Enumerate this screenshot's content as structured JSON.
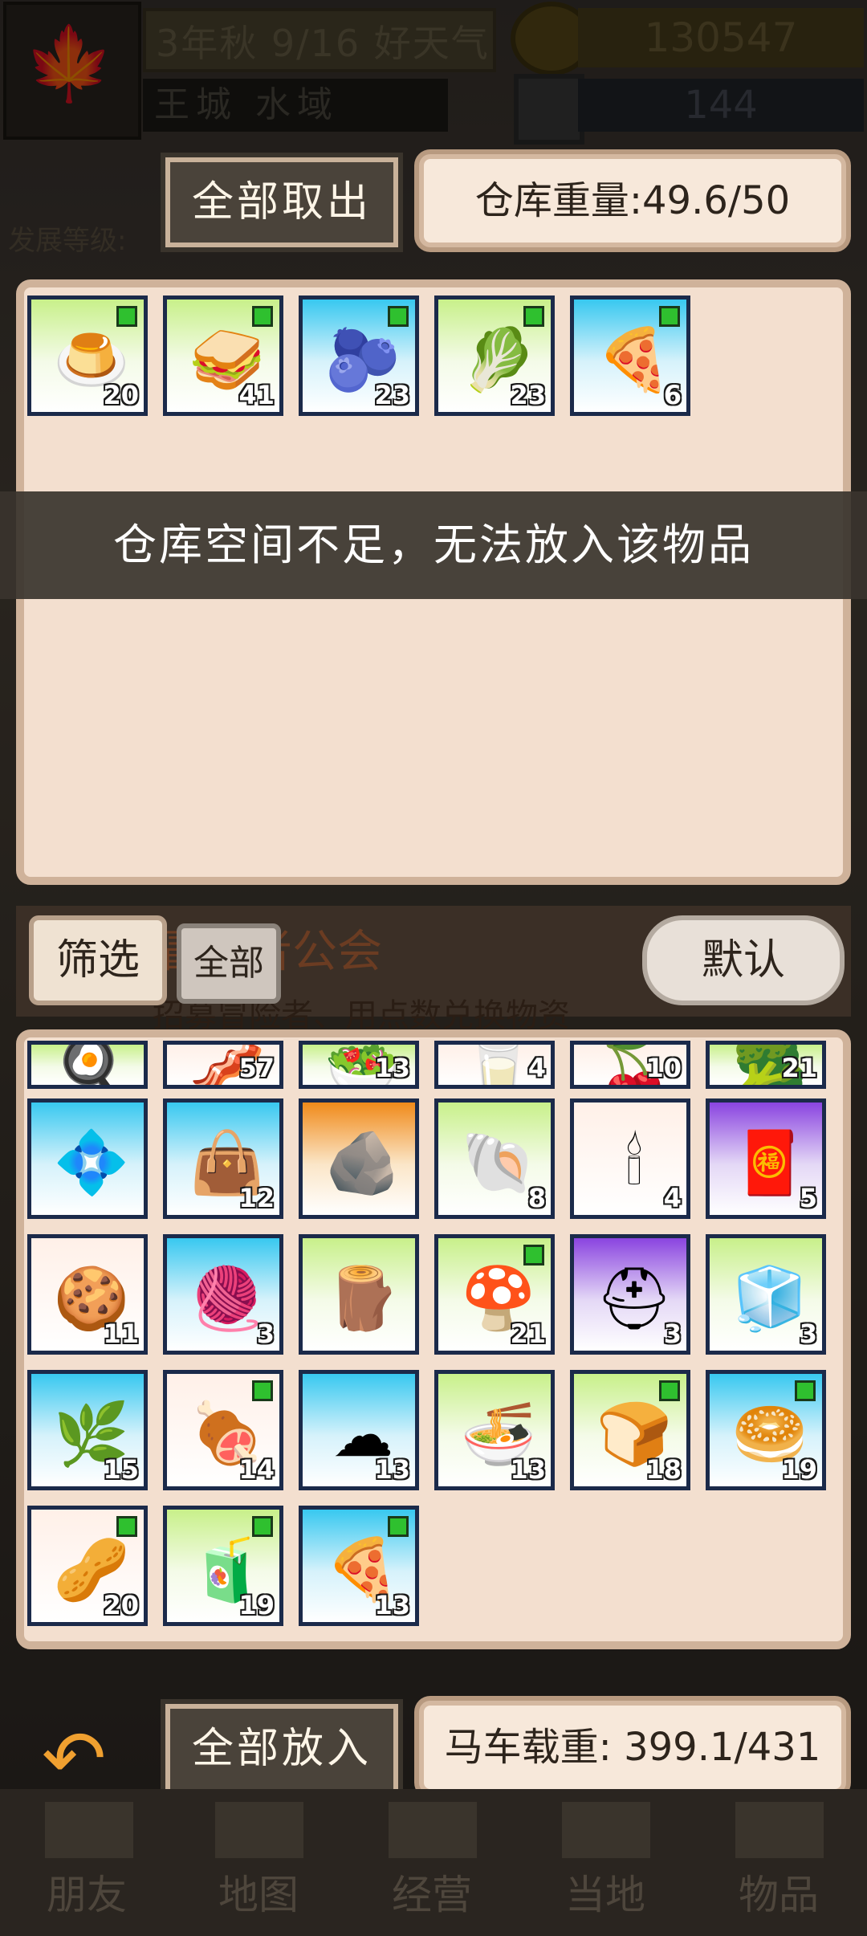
{
  "hud": {
    "date": "3年秋 9/16 好天气",
    "location": "王城 水域",
    "coins": "130547",
    "gems": "144",
    "dev_level_label": "发展等级:"
  },
  "storage": {
    "take_all_label": "全部取出",
    "weight_label": "仓库重量:49.6/50",
    "items": [
      {
        "icon": "matcha-pudding-icon",
        "glyph": "🍮",
        "qty": "20",
        "bg": "green",
        "dot": true
      },
      {
        "icon": "sandwich-icon",
        "glyph": "🥪",
        "qty": "41",
        "bg": "green",
        "dot": true
      },
      {
        "icon": "blueberry-jelly-icon",
        "glyph": "🫐",
        "qty": "23",
        "bg": "blue",
        "dot": true
      },
      {
        "icon": "radish-bundle-icon",
        "glyph": "🥬",
        "qty": "23",
        "bg": "green",
        "dot": true
      },
      {
        "icon": "pizza-slice-icon",
        "glyph": "🍕",
        "qty": "6",
        "bg": "blue",
        "dot": true
      }
    ]
  },
  "toast": "仓库空间不足，无法放入该物品",
  "filter": {
    "filter_label": "筛选",
    "all_label": "全部",
    "default_label": "默认",
    "bg_guild_text": "冒险者公会",
    "bg_guild_sub": "招募冒险者、用点数兑换物资"
  },
  "cart": {
    "partial_row": [
      "",
      "57",
      "13",
      "4",
      "10",
      "21"
    ],
    "rows": [
      [
        {
          "icon": "purple-crystal-icon",
          "glyph": "💠",
          "qty": "",
          "bg": "blue",
          "dot": false
        },
        {
          "icon": "leather-bag-icon",
          "glyph": "👜",
          "qty": "12",
          "bg": "blue",
          "dot": false
        },
        {
          "icon": "ore-stones-icon",
          "glyph": "🪨",
          "qty": "",
          "bg": "orange",
          "dot": false
        },
        {
          "icon": "snail-shell-icon",
          "glyph": "🐚",
          "qty": "8",
          "bg": "green",
          "dot": false
        },
        {
          "icon": "candle-icon",
          "glyph": "🕯",
          "qty": "4",
          "bg": "white",
          "dot": false
        },
        {
          "icon": "red-cloth-icon",
          "glyph": "🧧",
          "qty": "5",
          "bg": "purple",
          "dot": false
        }
      ],
      [
        {
          "icon": "gingerbread-icon",
          "glyph": "🍪",
          "qty": "11",
          "bg": "white",
          "dot": false
        },
        {
          "icon": "rope-coil-icon",
          "glyph": "🧶",
          "qty": "3",
          "bg": "blue",
          "dot": false
        },
        {
          "icon": "wood-logs-icon",
          "glyph": "🪵",
          "qty": "",
          "bg": "green",
          "dot": false
        },
        {
          "icon": "red-mushroom-icon",
          "glyph": "🍄",
          "qty": "21",
          "bg": "green",
          "dot": true
        },
        {
          "icon": "iron-helmet-icon",
          "glyph": "⛑",
          "qty": "3",
          "bg": "purple",
          "dot": false
        },
        {
          "icon": "steel-ingot-icon",
          "glyph": "🧊",
          "qty": "3",
          "bg": "green",
          "dot": false
        }
      ],
      [
        {
          "icon": "herb-bundle-icon",
          "glyph": "🌿",
          "qty": "15",
          "bg": "blue",
          "dot": false
        },
        {
          "icon": "meat-skewer-icon",
          "glyph": "🍖",
          "qty": "14",
          "bg": "white",
          "dot": true
        },
        {
          "icon": "white-fluff-icon",
          "glyph": "☁",
          "qty": "13",
          "bg": "blue",
          "dot": false
        },
        {
          "icon": "noodle-bowl-icon",
          "glyph": "🍜",
          "qty": "13",
          "bg": "green",
          "dot": false
        },
        {
          "icon": "bread-loaf-icon",
          "glyph": "🍞",
          "qty": "18",
          "bg": "green",
          "dot": true
        },
        {
          "icon": "cinnamon-roll-icon",
          "glyph": "🥯",
          "qty": "19",
          "bg": "blue",
          "dot": true
        }
      ],
      [
        {
          "icon": "nut-mix-icon",
          "glyph": "🥜",
          "qty": "20",
          "bg": "white",
          "dot": true
        },
        {
          "icon": "juice-pitcher-icon",
          "glyph": "🧃",
          "qty": "19",
          "bg": "green",
          "dot": true
        },
        {
          "icon": "pizza-slice-icon",
          "glyph": "🍕",
          "qty": "13",
          "bg": "blue",
          "dot": true
        }
      ]
    ],
    "put_all_label": "全部放入",
    "weight_label": "马车载重: 399.1/431"
  },
  "nav": [
    "朋友",
    "地图",
    "经营",
    "当地",
    "物品"
  ]
}
